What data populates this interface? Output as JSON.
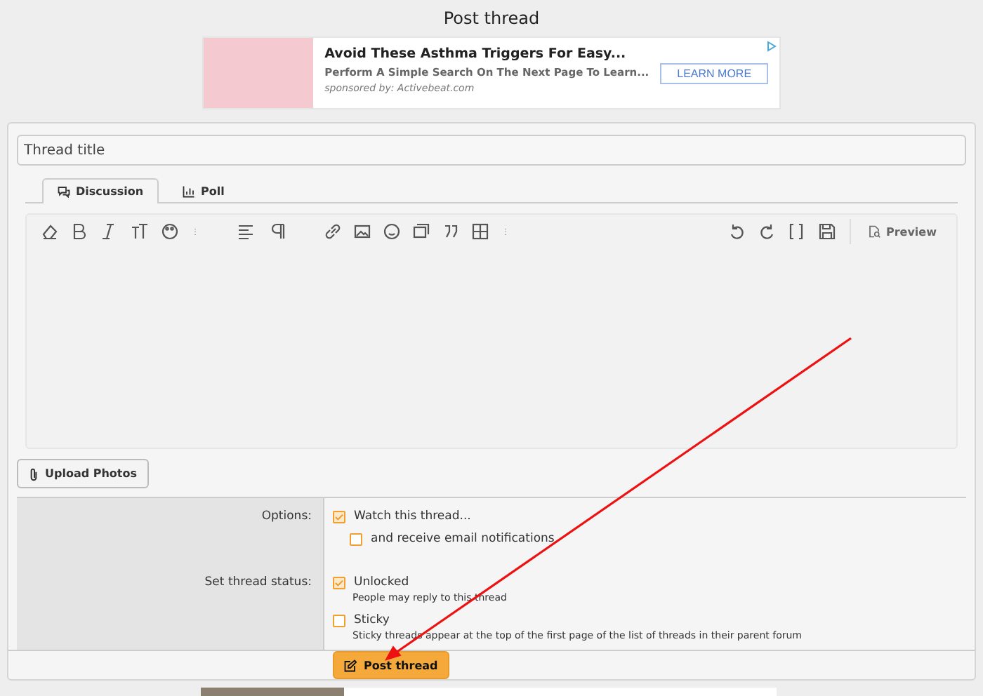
{
  "page_title": "Post thread",
  "top_ad": {
    "headline": "Avoid These Asthma Triggers For Easy...",
    "subline": "Perform A Simple Search On The Next Page To Learn...",
    "sponsor": "sponsored by: Activebeat.com",
    "button": "LEARN MORE"
  },
  "thread_title": {
    "placeholder": "Thread title"
  },
  "tabs": [
    {
      "label": "Discussion",
      "selected": true,
      "kind": "discussion"
    },
    {
      "label": "Poll",
      "selected": false,
      "kind": "poll"
    }
  ],
  "editor": {
    "preview": "Preview"
  },
  "upload_button": "Upload Photos",
  "options": [
    {
      "label": "Options:",
      "items": [
        {
          "label": "Watch this thread...",
          "checked": true,
          "children": [
            {
              "label": "and receive email notifications",
              "checked": false
            }
          ]
        }
      ]
    },
    {
      "label": "Set thread status:",
      "items": [
        {
          "label": "Unlocked",
          "checked": true,
          "hint": "People may reply to this thread"
        },
        {
          "label": "Sticky",
          "checked": false,
          "hint": "Sticky threads appear at the top of the first page of the list of threads in their parent forum"
        }
      ]
    }
  ],
  "submit_button": "Post thread"
}
